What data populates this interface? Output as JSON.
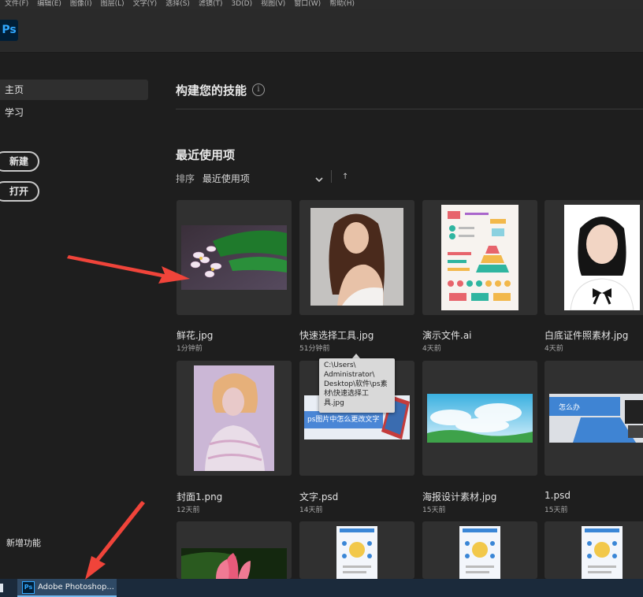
{
  "menubar": {
    "items": [
      "文件(F)",
      "编辑(E)",
      "图像(I)",
      "图层(L)",
      "文字(Y)",
      "选择(S)",
      "滤镜(T)",
      "3D(D)",
      "视图(V)",
      "窗口(W)",
      "帮助(H)"
    ]
  },
  "app": {
    "logo": "Ps"
  },
  "sidebar": {
    "home": "主页",
    "learn": "学习",
    "new_button": "新建",
    "open_button": "打开",
    "whats_new": "新增功能"
  },
  "main": {
    "skills_title": "构建您的技能",
    "info_icon": "i",
    "recent_title": "最近使用项",
    "sort_label": "排序",
    "sort_value": "最近使用项",
    "sort_direction_icon": "↑"
  },
  "files": [
    {
      "name": "鲜花.jpg",
      "time": "1分钟前",
      "icon": "flower-thumbnail"
    },
    {
      "name": "快速选择工具.jpg",
      "time": "51分钟前",
      "icon": "portrait-thumbnail"
    },
    {
      "name": "演示文件.ai",
      "time": "4天前",
      "icon": "infographic-thumbnail"
    },
    {
      "name": "白底证件照素材.jpg",
      "time": "4天前",
      "icon": "id-photo-thumbnail"
    },
    {
      "name": "封面1.png",
      "time": "12天前",
      "icon": "portrait-thumbnail"
    },
    {
      "name": "文字.psd",
      "time": "14天前",
      "icon": "banner-thumbnail",
      "overlay_text": "ps图片中怎么更改文字"
    },
    {
      "name": "海报设计素材.jpg",
      "time": "15天前",
      "icon": "sky-thumbnail"
    },
    {
      "name": "1.psd",
      "time": "15天前",
      "icon": "laptop-thumbnail",
      "overlay_text": "怎么办"
    }
  ],
  "tooltip": {
    "lines": [
      "C:\\Users\\",
      "Administrator\\",
      "Desktop\\软件\\ps素",
      "材\\快速选择工",
      "具.jpg"
    ]
  },
  "taskbar": {
    "app_label": "Adobe Photoshop...",
    "app_icon": "Ps"
  },
  "colors": {
    "background": "#1e1e1e",
    "panel": "#303030",
    "accent": "#31a8ff",
    "arrow": "#f0443a"
  }
}
